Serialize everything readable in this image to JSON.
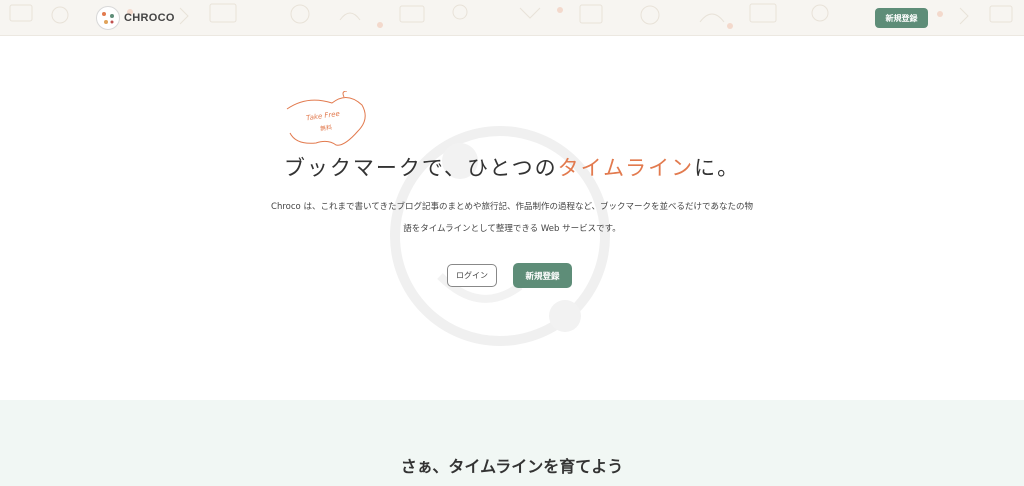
{
  "header": {
    "logo_text": "CHROCO",
    "signup_label": "新規登録"
  },
  "hero": {
    "badge_line1": "Take Free",
    "badge_line2": "無料",
    "headline_part1": "ブックマークで、ひとつの",
    "headline_accent": "タイムライン",
    "headline_part2": "に。",
    "description_line1": "Chroco は、これまで書いてきたブログ記事のまとめや旅行記、作品制作の過程など、ブックマークを並べるだけであなたの物",
    "description_line2": "語をタイムラインとして整理できる Web サービスです。",
    "login_label": "ログイン",
    "signup_label": "新規登録"
  },
  "section2": {
    "title": "さぁ、タイムラインを育てよう"
  },
  "colors": {
    "accent_orange": "#e27a4e",
    "brand_green": "#5e8d78",
    "section_bg": "#f1f7f4"
  }
}
